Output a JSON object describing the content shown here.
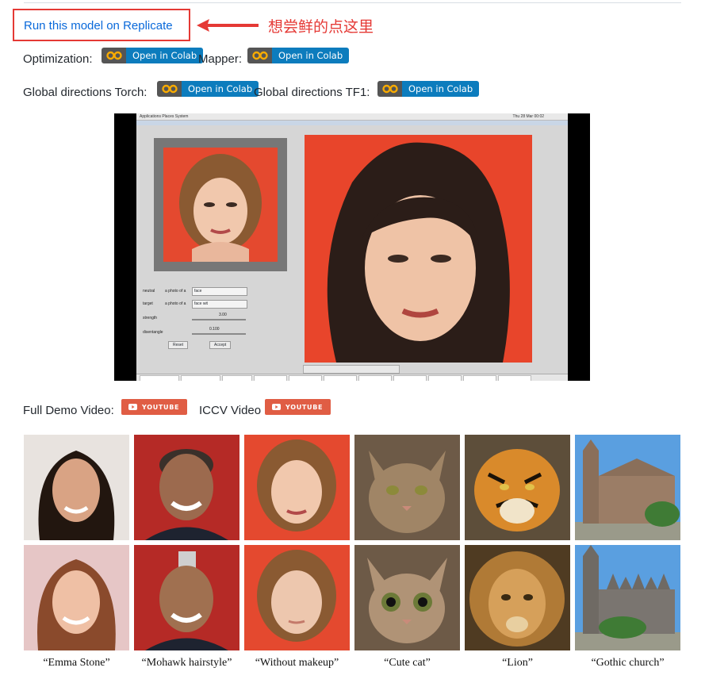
{
  "replicate": {
    "link_text": "Run this model on Replicate",
    "annotation": "想尝鲜的点这里"
  },
  "colab_rows": {
    "optimization_label": "Optimization:",
    "mapper_label": "Mapper:",
    "global_torch_label": "Global directions Torch:",
    "global_tf1_label": "Global directions TF1:",
    "badge_text": "Open in Colab",
    "badge_icon": "colab-logo-icon"
  },
  "videos": {
    "full_demo_label": "Full Demo Video:",
    "iccv_label": "ICCV Video",
    "badge_text": "YOUTUBE",
    "badge_icon": "youtube-play-icon"
  },
  "demo": {
    "topbar_text": "Applications  Places  System",
    "clock_text": "Thu 28 Mar 00:02",
    "controls": [
      {
        "name": "neutral",
        "hint": "a photo of a",
        "value": "face"
      },
      {
        "name": "target",
        "hint": "a photo of a",
        "value": "face wit"
      }
    ],
    "strength_label": "strength",
    "strength_value": "3.00",
    "disentangle_label": "disentangle",
    "disentangle_value": "0.100",
    "reset_label": "Reset",
    "accept_label": "Accept"
  },
  "captions": [
    "“Emma Stone”",
    "“Mohawk hairstyle”",
    "“Without makeup”",
    "“Cute cat”",
    "“Lion”",
    "“Gothic church”"
  ],
  "colors": {
    "link": "#0969da",
    "annotation_red": "#e53935",
    "colab_blue": "#0c7cbd",
    "youtube_red": "#e05d44"
  }
}
